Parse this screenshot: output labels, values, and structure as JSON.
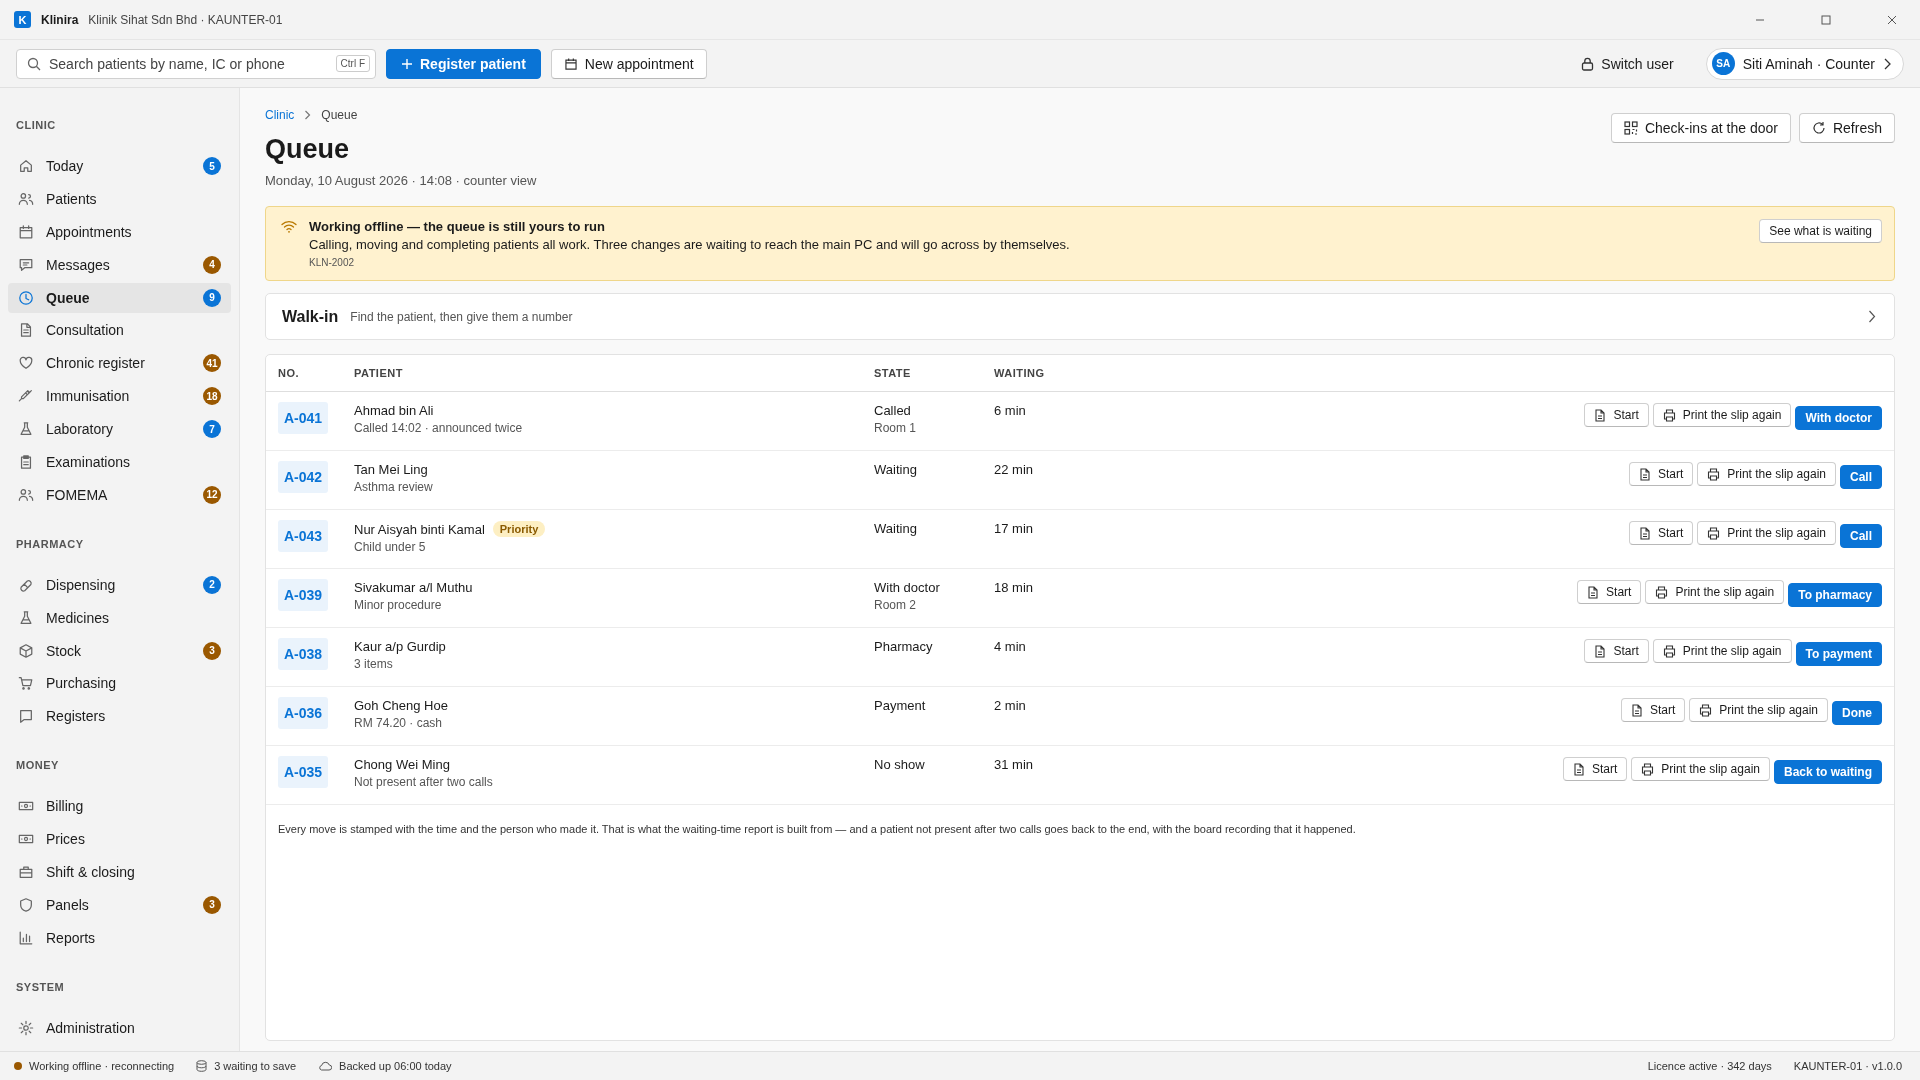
{
  "window": {
    "logo": "K",
    "app": "Klinira",
    "subtitle": "Klinik Sihat Sdn Bhd · KAUNTER-01"
  },
  "toolbar": {
    "search": {
      "placeholder": "Search patients by name, IC or phone",
      "shortcut": "Ctrl F"
    },
    "register_button": "Register patient",
    "appointment_button": "New appointment",
    "switch_user": "Switch user",
    "user": {
      "initials": "SA",
      "label": "Siti Aminah · Counter"
    }
  },
  "sidebar": {
    "sections": [
      {
        "title": "CLINIC",
        "items": [
          {
            "label": "Today",
            "badge": "5",
            "color": "#0a74d6",
            "selected": false
          },
          {
            "label": "Patients",
            "selected": false
          },
          {
            "label": "Appointments",
            "selected": false
          },
          {
            "label": "Messages",
            "badge": "4",
            "color": "#9a5800",
            "selected": false
          },
          {
            "label": "Queue",
            "badge": "9",
            "color": "#0a74d6",
            "selected": true
          },
          {
            "label": "Consultation",
            "selected": false
          },
          {
            "label": "Chronic register",
            "badge": "41",
            "color": "#9a5800",
            "selected": false
          },
          {
            "label": "Immunisation",
            "badge": "18",
            "color": "#9a5800",
            "selected": false
          },
          {
            "label": "Laboratory",
            "badge": "7",
            "color": "#0a74d6",
            "selected": false
          },
          {
            "label": "Examinations",
            "selected": false
          },
          {
            "label": "FOMEMA",
            "badge": "12",
            "color": "#9a5800",
            "selected": false
          }
        ]
      },
      {
        "title": "PHARMACY",
        "items": [
          {
            "label": "Dispensing",
            "badge": "2",
            "color": "#0a74d6",
            "selected": false
          },
          {
            "label": "Medicines",
            "selected": false
          },
          {
            "label": "Stock",
            "badge": "3",
            "color": "#9a5800",
            "selected": false
          },
          {
            "label": "Purchasing",
            "selected": false
          },
          {
            "label": "Registers",
            "selected": false
          }
        ]
      },
      {
        "title": "MONEY",
        "items": [
          {
            "label": "Billing",
            "selected": false
          },
          {
            "label": "Prices",
            "selected": false
          },
          {
            "label": "Shift & closing",
            "selected": false
          },
          {
            "label": "Panels",
            "badge": "3",
            "color": "#9a5800",
            "selected": false
          },
          {
            "label": "Reports",
            "selected": false
          }
        ]
      },
      {
        "title": "SYSTEM",
        "items": [
          {
            "label": "Administration",
            "selected": false
          }
        ]
      }
    ]
  },
  "breadcrumb": [
    "Clinic",
    "Queue"
  ],
  "page": {
    "title": "Queue",
    "subtitle": "Monday, 10 August 2026 · 14:08 · counter view",
    "buttons": [
      "Check-ins at the door",
      "Refresh"
    ]
  },
  "banner": {
    "title": "Working offline — the queue is still yours to run",
    "text": "Calling, moving and completing patients all work. Three changes are waiting to reach the main PC and will go across by themselves.",
    "code": "KLN-2002",
    "button": "See what is waiting"
  },
  "walk_in": {
    "title": "Walk-in",
    "hint": "Find the patient, then give them a number"
  },
  "table": {
    "columns": [
      "NO.",
      "PATIENT",
      "STATE",
      "WAITING"
    ],
    "rows": [
      {
        "number": "A-041",
        "name": "Ahmad bin Ali",
        "detail": "Called 14:02 · announced twice",
        "state": "Called",
        "state_detail": "Room 1",
        "waiting": "6 min",
        "actions": [
          "Start",
          "Print the slip again"
        ],
        "primary": "With doctor"
      },
      {
        "number": "A-042",
        "name": "Tan Mei Ling",
        "detail": "Asthma review",
        "state": "Waiting",
        "waiting": "22 min",
        "actions": [
          "Start",
          "Print the slip again"
        ],
        "primary": "Call"
      },
      {
        "number": "A-043",
        "name": "Nur Aisyah binti Kamal",
        "tag": "Priority",
        "detail": "Child under 5",
        "state": "Waiting",
        "waiting": "17 min",
        "actions": [
          "Start",
          "Print the slip again"
        ],
        "primary": "Call"
      },
      {
        "number": "A-039",
        "name": "Sivakumar a/l Muthu",
        "detail": "Minor procedure",
        "state": "With doctor",
        "state_detail": "Room 2",
        "waiting": "18 min",
        "actions": [
          "Start",
          "Print the slip again"
        ],
        "primary": "To pharmacy"
      },
      {
        "number": "A-038",
        "name": "Kaur a/p Gurdip",
        "detail": "3 items",
        "state": "Pharmacy",
        "waiting": "4 min",
        "actions": [
          "Start",
          "Print the slip again"
        ],
        "primary": "To payment"
      },
      {
        "number": "A-036",
        "name": "Goh Cheng Hoe",
        "detail": "RM 74.20 · cash",
        "state": "Payment",
        "waiting": "2 min",
        "actions": [
          "Start",
          "Print the slip again"
        ],
        "primary": "Done"
      },
      {
        "number": "A-035",
        "name": "Chong Wei Ming",
        "detail": "Not present after two calls",
        "state": "No show",
        "waiting": "31 min",
        "actions": [
          "Start",
          "Print the slip again"
        ],
        "primary": "Back to waiting"
      }
    ]
  },
  "footnote": "Every move is stamped with the time and the person who made it. That is what the waiting-time report is built from — and a patient not present after two calls goes back to the end, with the board recording that it happened.",
  "status_bar": {
    "connection": "Working offline · reconnecting",
    "pending": "3 waiting to save",
    "backup": "Backed up 06:00 today",
    "licence": "Licence active · 342 days",
    "version": "KAUNTER-01 · v1.0.0"
  }
}
